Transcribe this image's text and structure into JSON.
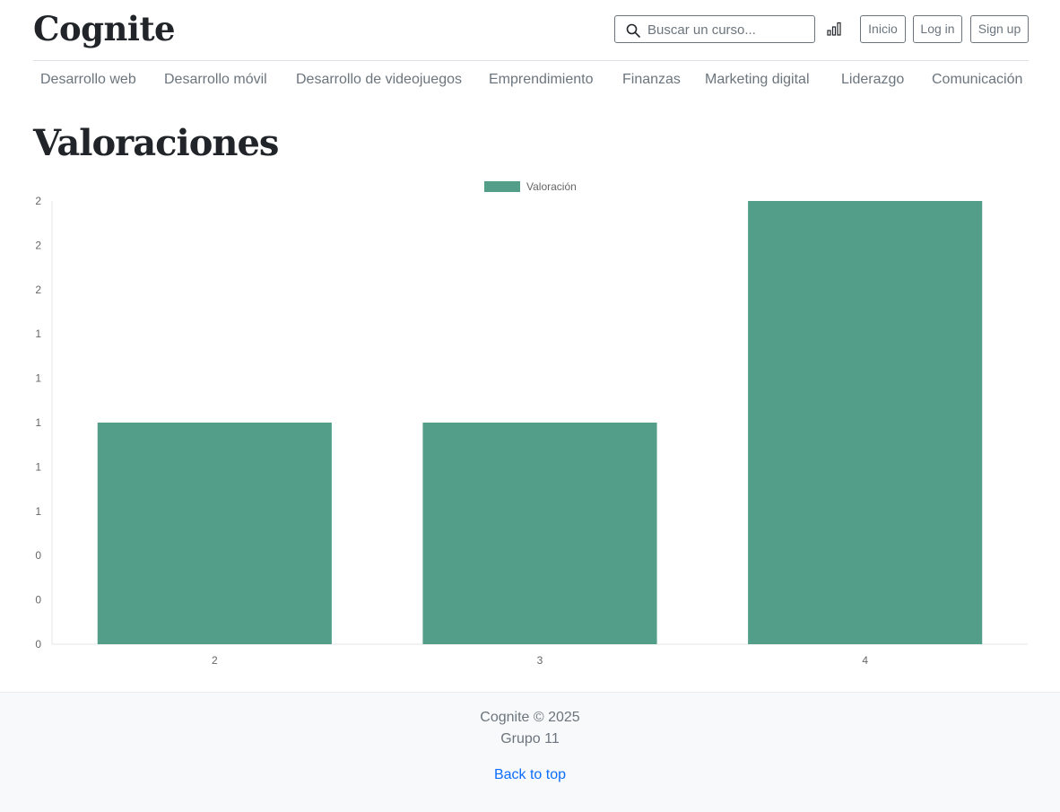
{
  "header": {
    "logo": "Cognite",
    "search": {
      "placeholder": "Buscar un curso..."
    },
    "buttons": {
      "inicio": "Inicio",
      "login": "Log in",
      "signup": "Sign up"
    }
  },
  "nav": {
    "items": [
      "Desarrollo web",
      "Desarrollo móvil",
      "Desarrollo de videojuegos",
      "Emprendimiento",
      "Finanzas",
      "Marketing digital",
      "Liderazgo",
      "Comunicación"
    ]
  },
  "main": {
    "title": "Valoraciones"
  },
  "chart_data": {
    "type": "bar",
    "categories": [
      "2",
      "3",
      "4"
    ],
    "series": [
      {
        "name": "Valoración",
        "values": [
          1,
          1,
          2
        ],
        "color": "#529e89"
      }
    ],
    "ylim": [
      0,
      2
    ],
    "yticks": [
      "0",
      "0",
      "0",
      "1",
      "1",
      "1",
      "1",
      "1",
      "2",
      "2",
      "2"
    ],
    "legend": "top-center",
    "grid": false
  },
  "footer": {
    "copyright": "Cognite © 2025",
    "group": "Grupo 11",
    "back_to_top": "Back to top"
  },
  "colors": {
    "accent": "#529e89",
    "link": "#0d6efd",
    "muted": "#6c757d"
  }
}
